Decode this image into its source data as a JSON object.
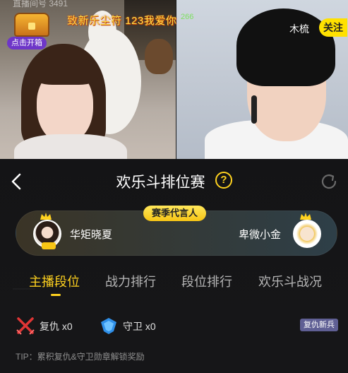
{
  "header": {
    "room_id": "直播间号 3491",
    "open_chest": "点击开箱",
    "banner_prefix": "致",
    "banner_text": "新乐尘符 123我爱你",
    "gift_tag": "266",
    "streamer_name": "木梳",
    "follow_label": "关注"
  },
  "panel": {
    "title": "欢乐斗排位赛",
    "help_glyph": "?",
    "tip": "TIP：累积复仇&守卫勋章解锁奖励"
  },
  "spokes": {
    "badge": "赛季代言人",
    "left_name": "华矩晓夏",
    "right_name": "卑微小金"
  },
  "tabs": [
    "主播段位",
    "战力排行",
    "段位排行",
    "欢乐斗战况"
  ],
  "stats": {
    "revenge": "复仇 x0",
    "guard": "守卫 x0",
    "badge": "复仇新兵"
  },
  "colors": {
    "accent": "#ffd21f",
    "follow_button": "#ffe100",
    "open_chest_button": "#6e36c8",
    "revenge_icon": "#e03535",
    "guard_icon": "#2f8fe8",
    "badge_bg": "#5f5f94"
  },
  "icons": [
    "chevron-left-icon",
    "help-icon",
    "refresh-icon",
    "crown-icon",
    "crossed-swords-icon",
    "shield-icon",
    "treasure-chest-icon"
  ]
}
